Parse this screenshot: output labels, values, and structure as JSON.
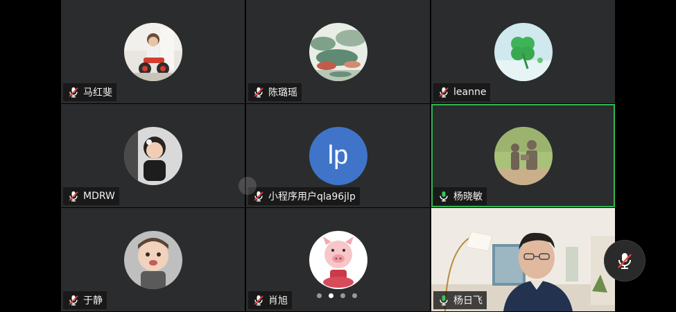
{
  "participants": [
    {
      "name": "马红斐",
      "avatar_icon": "child-on-tricycle-photo",
      "mic": "muted"
    },
    {
      "name": "陈璐瑶",
      "avatar_icon": "landscape-painting-photo",
      "mic": "muted"
    },
    {
      "name": "leanne",
      "avatar_icon": "four-leaf-clover-photo",
      "mic": "muted"
    },
    {
      "name": "MDRW",
      "avatar_icon": "girl-portrait-photo",
      "mic": "muted"
    },
    {
      "name": "小程序用户qla96jlp",
      "avatar_icon": "initials-avatar",
      "initials": "lp",
      "mic": "muted"
    },
    {
      "name": "杨晓敏",
      "avatar_icon": "statues-photo",
      "mic": "active"
    },
    {
      "name": "于静",
      "avatar_icon": "baby-face-photo",
      "mic": "muted"
    },
    {
      "name": "肖旭",
      "avatar_icon": "cartoon-pig-photo",
      "mic": "muted"
    },
    {
      "name": "杨日飞",
      "avatar_icon": "live-video",
      "mic": "active"
    }
  ],
  "pagination": {
    "pages": 4,
    "current": 2
  },
  "float_mic": {
    "state": "muted",
    "icon": "mic-muted-icon"
  },
  "colors": {
    "tile_bg": "#2b2c2e",
    "active_border": "#2fb84f",
    "initials_bg": "#3f74c9",
    "muted_red": "#e0443b",
    "active_green": "#35c759"
  }
}
